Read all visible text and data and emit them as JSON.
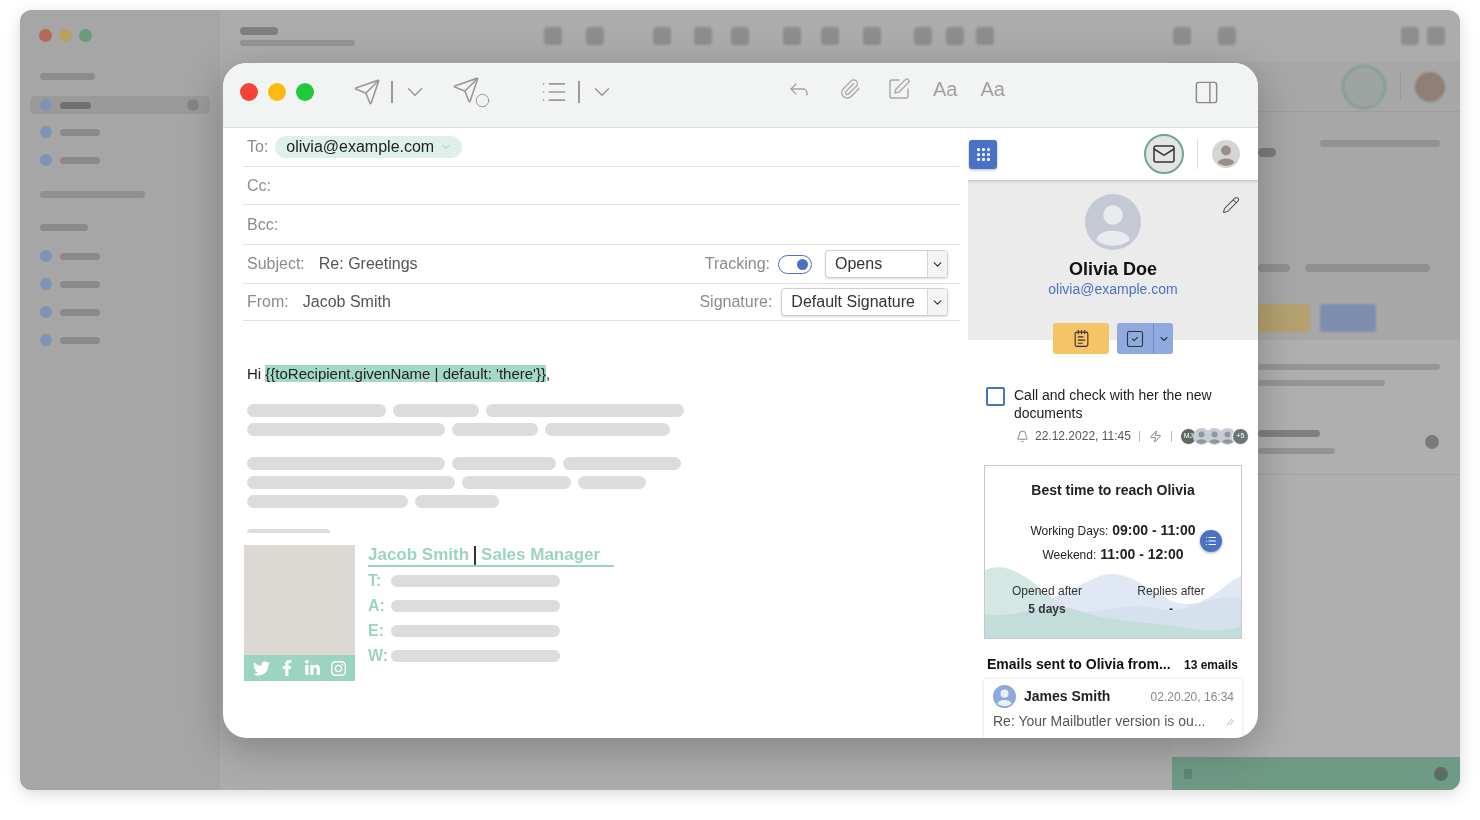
{
  "toolbar": {
    "font_buttons": [
      {
        "label": "Aa"
      },
      {
        "label": "Aa"
      }
    ]
  },
  "header_fields": [
    {
      "kind": "recipients",
      "label": "To:",
      "chips": [
        "olivia@example.com"
      ]
    },
    {
      "kind": "recipients",
      "label": "Cc:"
    },
    {
      "kind": "recipients",
      "label": "Bcc:"
    },
    {
      "kind": "text",
      "label": "Subject:",
      "value": "Re: Greetings",
      "option": {
        "label": "Tracking:",
        "toggle_on": true,
        "select_value": "Opens"
      }
    },
    {
      "kind": "text",
      "label": "From:",
      "value": "Jacob Smith",
      "option": {
        "label": "Signature:",
        "select_value": "Default Signature"
      }
    }
  ],
  "body": {
    "greeting": "Hi",
    "placeholder_tag": "{{toRecipient.givenName | default: 'there'}}",
    "punctuation": ","
  },
  "signature": {
    "name": "Jacob Smith",
    "title": "Sales Manager",
    "contact_labels": [
      "T:",
      "A:",
      "E:",
      "W:"
    ]
  },
  "side_panel": {
    "tabs": [
      {
        "kind": "mail",
        "selected": true
      },
      {
        "kind": "profile",
        "selected": false
      }
    ],
    "contact": {
      "name": "Olivia Doe",
      "email": "olivia@example.com"
    },
    "task": {
      "text": "Call and check with her the new documents",
      "checked": false,
      "reminder": "22.12.2022, 11:45",
      "assignees": [
        {
          "kind": "initials",
          "label": "MJ"
        },
        {
          "kind": "photo"
        },
        {
          "kind": "photo"
        },
        {
          "kind": "photo"
        },
        {
          "kind": "more",
          "label": "+5"
        }
      ]
    },
    "best_time": {
      "title": "Best time to reach Olivia",
      "slots": [
        {
          "label": "Working Days:",
          "value": "09:00 - 11:00"
        },
        {
          "label": "Weekend:",
          "value": "11:00 - 12:00"
        }
      ],
      "stats": [
        {
          "label": "Opened after",
          "value": "5 days"
        },
        {
          "label": "Replies after",
          "value": "-"
        }
      ]
    },
    "emails": {
      "title": "Emails sent to Olivia from...",
      "count": "13 emails",
      "items": [
        {
          "sender": "James Smith",
          "date": "02.20.20, 16:34",
          "subject": "Re: Your Mailbutler version is ou..."
        }
      ]
    }
  }
}
